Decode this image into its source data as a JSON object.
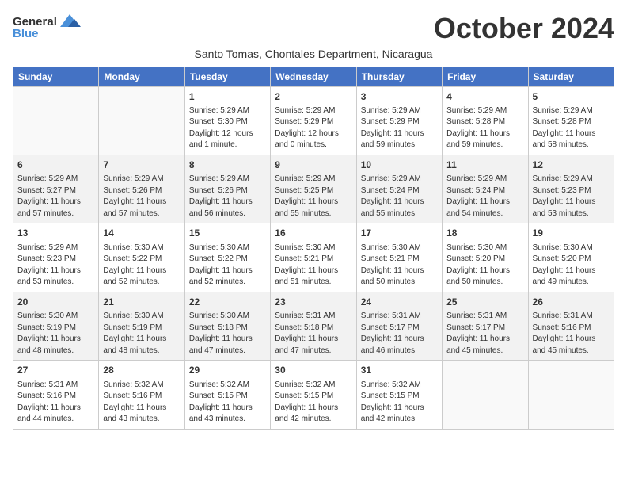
{
  "logo": {
    "general": "General",
    "blue": "Blue"
  },
  "header": {
    "month": "October 2024",
    "subtitle": "Santo Tomas, Chontales Department, Nicaragua"
  },
  "weekdays": [
    "Sunday",
    "Monday",
    "Tuesday",
    "Wednesday",
    "Thursday",
    "Friday",
    "Saturday"
  ],
  "weeks": [
    [
      {
        "day": "",
        "info": ""
      },
      {
        "day": "",
        "info": ""
      },
      {
        "day": "1",
        "info": "Sunrise: 5:29 AM\nSunset: 5:30 PM\nDaylight: 12 hours\nand 1 minute."
      },
      {
        "day": "2",
        "info": "Sunrise: 5:29 AM\nSunset: 5:29 PM\nDaylight: 12 hours\nand 0 minutes."
      },
      {
        "day": "3",
        "info": "Sunrise: 5:29 AM\nSunset: 5:29 PM\nDaylight: 11 hours\nand 59 minutes."
      },
      {
        "day": "4",
        "info": "Sunrise: 5:29 AM\nSunset: 5:28 PM\nDaylight: 11 hours\nand 59 minutes."
      },
      {
        "day": "5",
        "info": "Sunrise: 5:29 AM\nSunset: 5:28 PM\nDaylight: 11 hours\nand 58 minutes."
      }
    ],
    [
      {
        "day": "6",
        "info": "Sunrise: 5:29 AM\nSunset: 5:27 PM\nDaylight: 11 hours\nand 57 minutes."
      },
      {
        "day": "7",
        "info": "Sunrise: 5:29 AM\nSunset: 5:26 PM\nDaylight: 11 hours\nand 57 minutes."
      },
      {
        "day": "8",
        "info": "Sunrise: 5:29 AM\nSunset: 5:26 PM\nDaylight: 11 hours\nand 56 minutes."
      },
      {
        "day": "9",
        "info": "Sunrise: 5:29 AM\nSunset: 5:25 PM\nDaylight: 11 hours\nand 55 minutes."
      },
      {
        "day": "10",
        "info": "Sunrise: 5:29 AM\nSunset: 5:24 PM\nDaylight: 11 hours\nand 55 minutes."
      },
      {
        "day": "11",
        "info": "Sunrise: 5:29 AM\nSunset: 5:24 PM\nDaylight: 11 hours\nand 54 minutes."
      },
      {
        "day": "12",
        "info": "Sunrise: 5:29 AM\nSunset: 5:23 PM\nDaylight: 11 hours\nand 53 minutes."
      }
    ],
    [
      {
        "day": "13",
        "info": "Sunrise: 5:29 AM\nSunset: 5:23 PM\nDaylight: 11 hours\nand 53 minutes."
      },
      {
        "day": "14",
        "info": "Sunrise: 5:30 AM\nSunset: 5:22 PM\nDaylight: 11 hours\nand 52 minutes."
      },
      {
        "day": "15",
        "info": "Sunrise: 5:30 AM\nSunset: 5:22 PM\nDaylight: 11 hours\nand 52 minutes."
      },
      {
        "day": "16",
        "info": "Sunrise: 5:30 AM\nSunset: 5:21 PM\nDaylight: 11 hours\nand 51 minutes."
      },
      {
        "day": "17",
        "info": "Sunrise: 5:30 AM\nSunset: 5:21 PM\nDaylight: 11 hours\nand 50 minutes."
      },
      {
        "day": "18",
        "info": "Sunrise: 5:30 AM\nSunset: 5:20 PM\nDaylight: 11 hours\nand 50 minutes."
      },
      {
        "day": "19",
        "info": "Sunrise: 5:30 AM\nSunset: 5:20 PM\nDaylight: 11 hours\nand 49 minutes."
      }
    ],
    [
      {
        "day": "20",
        "info": "Sunrise: 5:30 AM\nSunset: 5:19 PM\nDaylight: 11 hours\nand 48 minutes."
      },
      {
        "day": "21",
        "info": "Sunrise: 5:30 AM\nSunset: 5:19 PM\nDaylight: 11 hours\nand 48 minutes."
      },
      {
        "day": "22",
        "info": "Sunrise: 5:30 AM\nSunset: 5:18 PM\nDaylight: 11 hours\nand 47 minutes."
      },
      {
        "day": "23",
        "info": "Sunrise: 5:31 AM\nSunset: 5:18 PM\nDaylight: 11 hours\nand 47 minutes."
      },
      {
        "day": "24",
        "info": "Sunrise: 5:31 AM\nSunset: 5:17 PM\nDaylight: 11 hours\nand 46 minutes."
      },
      {
        "day": "25",
        "info": "Sunrise: 5:31 AM\nSunset: 5:17 PM\nDaylight: 11 hours\nand 45 minutes."
      },
      {
        "day": "26",
        "info": "Sunrise: 5:31 AM\nSunset: 5:16 PM\nDaylight: 11 hours\nand 45 minutes."
      }
    ],
    [
      {
        "day": "27",
        "info": "Sunrise: 5:31 AM\nSunset: 5:16 PM\nDaylight: 11 hours\nand 44 minutes."
      },
      {
        "day": "28",
        "info": "Sunrise: 5:32 AM\nSunset: 5:16 PM\nDaylight: 11 hours\nand 43 minutes."
      },
      {
        "day": "29",
        "info": "Sunrise: 5:32 AM\nSunset: 5:15 PM\nDaylight: 11 hours\nand 43 minutes."
      },
      {
        "day": "30",
        "info": "Sunrise: 5:32 AM\nSunset: 5:15 PM\nDaylight: 11 hours\nand 42 minutes."
      },
      {
        "day": "31",
        "info": "Sunrise: 5:32 AM\nSunset: 5:15 PM\nDaylight: 11 hours\nand 42 minutes."
      },
      {
        "day": "",
        "info": ""
      },
      {
        "day": "",
        "info": ""
      }
    ]
  ]
}
